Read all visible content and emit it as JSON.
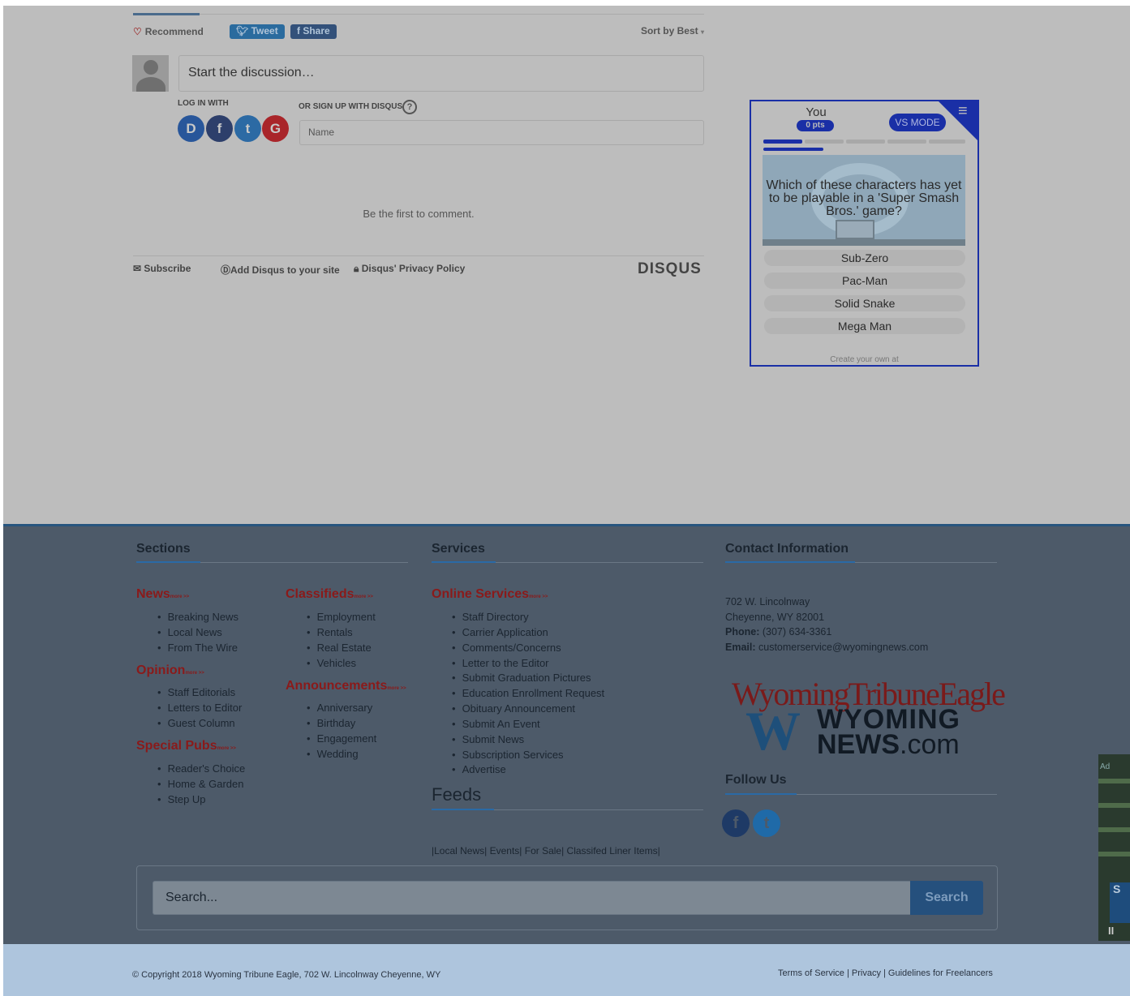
{
  "disqus": {
    "recommend": "Recommend",
    "tweet": "Tweet",
    "share": "Share",
    "sort": "Sort by Best",
    "discussion_placeholder": "Start the discussion…",
    "login_with": "LOG IN WITH",
    "signup_with": "OR SIGN UP WITH DISQUS",
    "name_placeholder": "Name",
    "first_comment": "Be the first to comment.",
    "subscribe": "Subscribe",
    "add_disqus": "Add Disqus to your site",
    "privacy": "Disqus' Privacy Policy",
    "logo": "DISQUS"
  },
  "quiz": {
    "you": "You",
    "pts": "0 pts",
    "vs_mode": "VS MODE",
    "question": "Which of these characters has yet to be playable in a 'Super Smash Bros.' game?",
    "options": [
      "Sub-Zero",
      "Pac-Man",
      "Solid Snake",
      "Mega Man"
    ],
    "create": "Create your own at"
  },
  "footer": {
    "sections_title": "Sections",
    "services_title": "Services",
    "contact_title": "Contact Information",
    "more": "more >>",
    "news": {
      "title": "News",
      "items": [
        "Breaking News",
        "Local News",
        "From The Wire"
      ]
    },
    "opinion": {
      "title": "Opinion",
      "items": [
        "Staff Editorials",
        "Letters to Editor",
        "Guest Column"
      ]
    },
    "special": {
      "title": "Special Pubs",
      "items": [
        "Reader's Choice",
        "Home & Garden",
        "Step Up"
      ]
    },
    "classifieds": {
      "title": "Classifieds",
      "items": [
        "Employment",
        "Rentals",
        "Real Estate",
        "Vehicles"
      ]
    },
    "announcements": {
      "title": "Announcements",
      "items": [
        "Anniversary",
        "Birthday",
        "Engagement",
        "Wedding"
      ]
    },
    "online": {
      "title": "Online Services",
      "items": [
        "Staff Directory",
        "Carrier Application",
        "Comments/Concerns",
        "Letter to the Editor",
        "Submit Graduation Pictures",
        "Education Enrollment Request",
        "Obituary Announcement",
        "Submit An Event",
        "Submit News",
        "Subscription Services",
        "Advertise"
      ]
    },
    "feeds_title": "Feeds",
    "feeds_links": "|Local News| Events| For Sale| Classifed Liner Items|",
    "contact": {
      "address1": "702 W. Lincolnway",
      "address2": "Cheyenne, WY 82001",
      "phone_label": "Phone:",
      "phone": "(307) 634-3361",
      "email_label": "Email:",
      "email": "customerservice@wyomingnews.com"
    },
    "logo_eagle": "WyomingTribuneEagle",
    "logo_w": "W",
    "logo_wyoming": "WYOMING",
    "logo_news": "NEWS",
    "logo_com": ".com",
    "follow_title": "Follow Us",
    "search_placeholder": "Search...",
    "search_button": "Search",
    "copyright": "© Copyright 2018 Wyoming Tribune Eagle, 702 W. Lincolnway Cheyenne, WY",
    "terms": "Terms of Service | Privacy | Guidelines for Freelancers"
  },
  "ad": {
    "label": "Ad",
    "letter": "S"
  }
}
